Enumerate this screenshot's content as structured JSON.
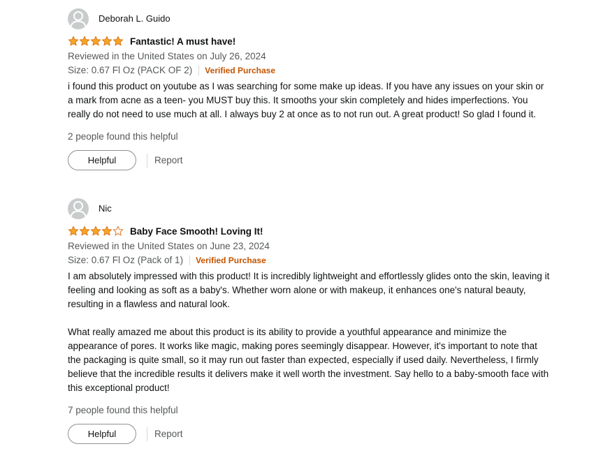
{
  "colors": {
    "star_fill": "#f5a623",
    "star_stroke": "#de7921",
    "verified": "#c45500",
    "muted_text": "#565959"
  },
  "reviews": [
    {
      "reviewer": "Deborah L. Guido",
      "rating": 5,
      "max_rating": 5,
      "title": "Fantastic! A must have!",
      "date_text": "Reviewed in the United States on July 26, 2024",
      "format": "Size: 0.67 Fl Oz (PACK OF 2)",
      "verified": "Verified Purchase",
      "body": [
        "i found this product on youtube as I was searching for some make up ideas. If you have any issues on your skin or a mark from acne as a teen- you MUST buy this. It smooths your skin completely and hides imperfections. You really do not need to use much at all. I always buy 2 at once as to not run out. A great product! So glad I found it."
      ],
      "helpful_text": "2 people found this helpful",
      "helpful_button": "Helpful",
      "report_label": "Report"
    },
    {
      "reviewer": "Nic",
      "rating": 4,
      "max_rating": 5,
      "title": "Baby Face Smooth! Loving It!",
      "date_text": "Reviewed in the United States on June 23, 2024",
      "format": "Size: 0.67 Fl Oz (Pack of 1)",
      "verified": "Verified Purchase",
      "body": [
        "I am absolutely impressed with this product! It is incredibly lightweight and effortlessly glides onto the skin, leaving it feeling and looking as soft as a baby's. Whether worn alone or with makeup, it enhances one's natural beauty, resulting in a flawless and natural look.",
        "What really amazed me about this product is its ability to provide a youthful appearance and minimize the appearance of pores. It works like magic, making pores seemingly disappear. However, it's important to note that the packaging is quite small, so it may run out faster than expected, especially if used daily. Nevertheless, I firmly believe that the incredible results it delivers make it well worth the investment. Say hello to a baby-smooth face with this exceptional product!"
      ],
      "helpful_text": "7 people found this helpful",
      "helpful_button": "Helpful",
      "report_label": "Report"
    }
  ]
}
